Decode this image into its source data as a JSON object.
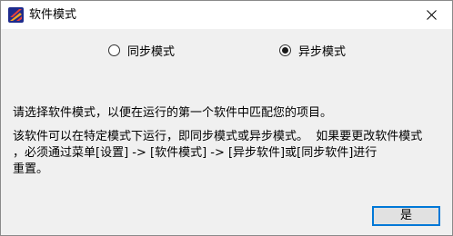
{
  "window": {
    "title": "软件模式",
    "close_icon": "close-icon",
    "app_icon": "app-logo-icon"
  },
  "mode_options": [
    {
      "label": "同步模式",
      "selected": false
    },
    {
      "label": "异步模式",
      "selected": true
    }
  ],
  "message": {
    "line1": "请选择软件模式，以便在运行的第一个软件中匹配您的项目。",
    "line2": "该软件可以在特定模式下运行，即同步模式或异步模式。  如果要更改软件模式",
    "line3": "，必须通过菜单[设置] -> [软件模式] -> [异步软件]或[同步软件]进行",
    "line4": "重置。"
  },
  "buttons": {
    "ok_label": "是"
  },
  "colors": {
    "accent": "#0078d7",
    "background": "#f0f0f0",
    "titlebar": "#ffffff"
  }
}
